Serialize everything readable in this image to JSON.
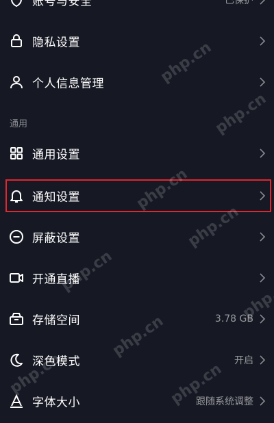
{
  "colors": {
    "background": "#161823",
    "text_primary": "#ffffff",
    "text_secondary": "rgba(255,255,255,0.55)",
    "highlight_border": "#e0262e"
  },
  "rows_top": [
    {
      "id": "account",
      "label": "账号与安全",
      "value": "已保护",
      "icon": "shield-icon"
    },
    {
      "id": "privacy",
      "label": "隐私设置",
      "value": "",
      "icon": "lock-icon"
    },
    {
      "id": "personal-info",
      "label": "个人信息管理",
      "value": "",
      "icon": "person-icon"
    }
  ],
  "section": {
    "title": "通用"
  },
  "rows_general": [
    {
      "id": "general",
      "label": "通用设置",
      "value": "",
      "icon": "grid-icon"
    },
    {
      "id": "notification",
      "label": "通知设置",
      "value": "",
      "icon": "bell-icon",
      "highlighted": true
    },
    {
      "id": "block",
      "label": "屏蔽设置",
      "value": "",
      "icon": "minus-circle-icon"
    },
    {
      "id": "live",
      "label": "开通直播",
      "value": "",
      "icon": "video-camera-icon"
    },
    {
      "id": "storage",
      "label": "存储空间",
      "value": "3.78 GB",
      "icon": "storage-icon"
    },
    {
      "id": "dark-mode",
      "label": "深色模式",
      "value": "开启",
      "icon": "moon-icon"
    },
    {
      "id": "font-size",
      "label": "字体大小",
      "value": "跟随系统调整",
      "icon": "font-icon"
    }
  ],
  "watermark": {
    "text": "php.cn"
  }
}
